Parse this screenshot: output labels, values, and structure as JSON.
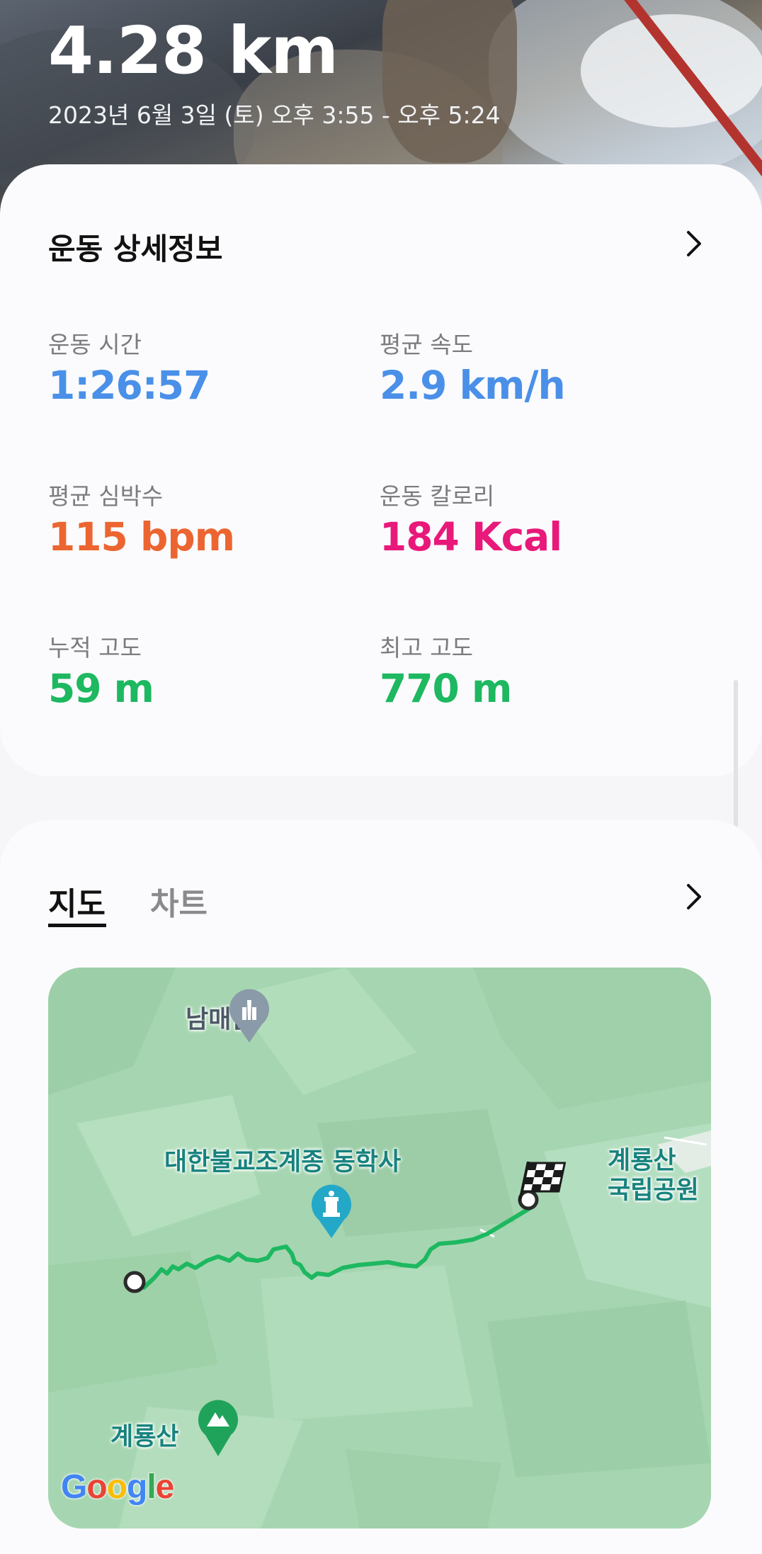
{
  "hero": {
    "distance": "4.28 km",
    "date_range": "2023년 6월 3일 (토) 오후 3:55 - 오후 5:24"
  },
  "details": {
    "title": "운동 상세정보",
    "stats": [
      {
        "label": "운동 시간",
        "value": "1:26:57",
        "color": "#4a90e8"
      },
      {
        "label": "평균 속도",
        "value": "2.9 km/h",
        "color": "#4a90e8"
      },
      {
        "label": "평균 심박수",
        "value": "115 bpm",
        "color": "#ec6531"
      },
      {
        "label": "운동 칼로리",
        "value": "184 Kcal",
        "color": "#e8197a"
      },
      {
        "label": "누적 고도",
        "value": "59 m",
        "color": "#1db860"
      },
      {
        "label": "최고 고도",
        "value": "770 m",
        "color": "#1db860"
      }
    ]
  },
  "map_section": {
    "tabs": [
      {
        "label": "지도",
        "selected": true
      },
      {
        "label": "차트",
        "selected": false
      }
    ],
    "map": {
      "labels": {
        "pagoda": "남매탑",
        "temple": "대한불교조계종 동학사",
        "park": "계룡산 국립공원",
        "mountain": "계룡산"
      },
      "attribution": "Google",
      "route_color": "#1db860"
    }
  },
  "icons": {
    "chevron": "chevron-right-icon",
    "finish": "checkered-flag-icon",
    "temple_pin": "temple-pin-icon",
    "pagoda_pin": "pagoda-pin-icon",
    "mountain_pin": "mountain-pin-icon"
  }
}
